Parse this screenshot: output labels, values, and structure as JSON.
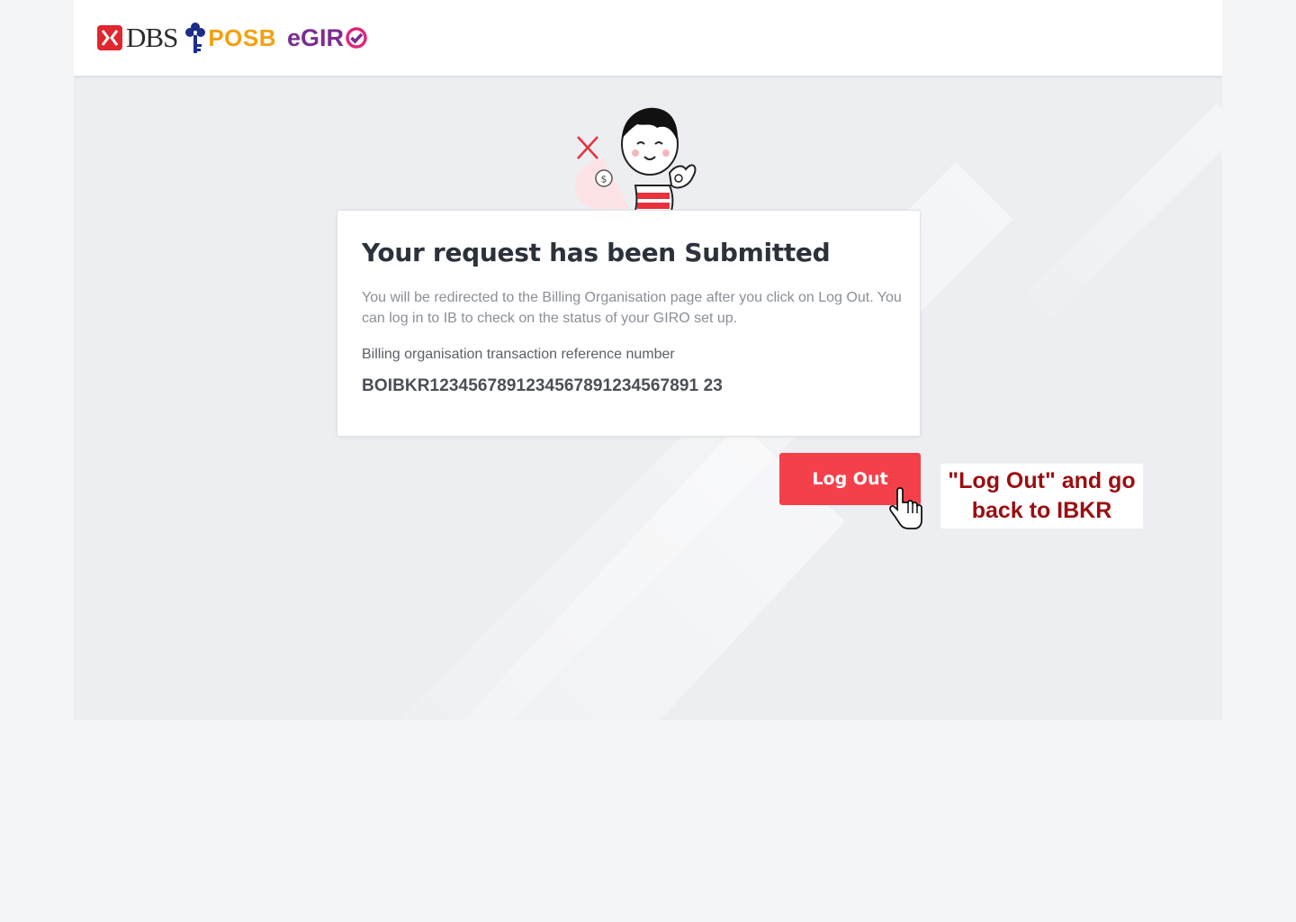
{
  "brand": {
    "dbs": "DBS",
    "posb": "POSB",
    "egiro": "eGIR"
  },
  "card": {
    "title": "Your request has been Submitted",
    "description": "You will be redirected to the Billing Organisation page after you click on Log Out. You can log in to IB to check on the status of your GIRO set up.",
    "ref_label": "Billing organisation transaction reference number",
    "ref_value": "BOIBKR1234567891234567891234567891 23"
  },
  "actions": {
    "logout_label": "Log Out"
  },
  "annotation": {
    "line1": "\"Log Out\" and go",
    "line2": "back to IBKR"
  },
  "colors": {
    "accent_red": "#f4404a",
    "annotation_red": "#9b0e11",
    "posb_orange": "#f5a00f",
    "egiro_purple": "#7b2d8e"
  }
}
